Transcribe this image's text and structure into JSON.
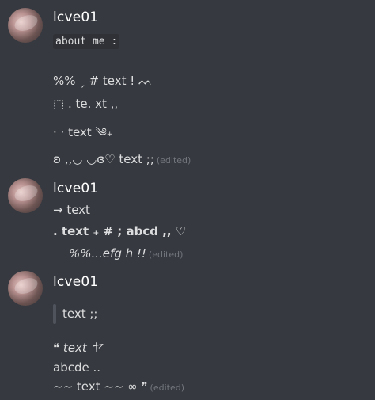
{
  "messages": [
    {
      "username": "lcve01",
      "lines": [
        "about me :",
        "%% ˏ # text ! ᨓ",
        "⬚ .  te. xt ,,",
        "· · text ༄₊",
        "ʚ ,,◡ ◡ɞ♡  text ;;"
      ],
      "edited": "(edited)"
    },
    {
      "username": "lcve01",
      "lines": [
        "→ text",
        ". text ₊ # ; abcd ,, ♡",
        "%%...efg h !!"
      ],
      "edited": "(edited)"
    },
    {
      "username": "lcve01",
      "lines": [
        "text  ;;",
        "❝ text  ヤ",
        "abcde ..",
        "~~ text ~~  ∞ ❞"
      ],
      "edited": "(edited)"
    }
  ]
}
